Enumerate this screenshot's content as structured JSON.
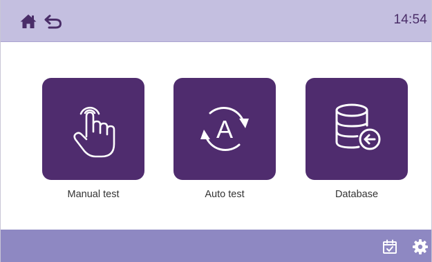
{
  "header": {
    "time": "14:54",
    "icons": {
      "home": "home-icon",
      "back": "back-arrow-icon"
    }
  },
  "tiles": [
    {
      "label": "Manual test",
      "icon": "hand-pointer-icon"
    },
    {
      "label": "Auto test",
      "icon": "auto-cycle-icon"
    },
    {
      "label": "Database",
      "icon": "database-icon"
    }
  ],
  "footer": {
    "icons": {
      "calendar": "calendar-check-icon",
      "settings": "gear-icon"
    }
  },
  "colors": {
    "topbar": "#c4bfe0",
    "tile": "#4f2c6e",
    "bottombar": "#8e88c2",
    "icon_dark": "#4a2d68"
  }
}
